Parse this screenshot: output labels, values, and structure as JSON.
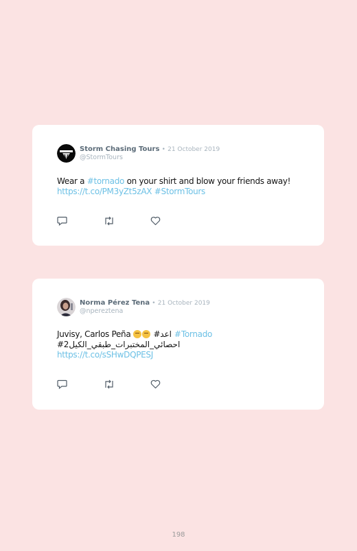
{
  "tweets": [
    {
      "author": "Storm Chasing Tours",
      "separator": "•",
      "date": "21 October 2019",
      "handle": "@StormTours",
      "text_before": "Wear a ",
      "hashtag1": "#tornado",
      "text_after": " on your shirt and blow your friends away!",
      "link": "https://t.co/PM3yZt5zAX",
      "hashtag2": "#StormTours"
    },
    {
      "author": "Norma Pérez Tena",
      "separator": "•",
      "date": "21 October 2019",
      "handle": "@npereztena",
      "text_before": "Juvisy, Carlos Peña ",
      "arabic1": "#اعد",
      "hashtag1": "#Tornado",
      "arabic2": "#احصائي_المختبرات_طبقي_الكيل2",
      "link": "https://t.co/sSHwDQPESJ"
    }
  ],
  "icons": [
    "reply-icon",
    "retweet-icon",
    "like-icon"
  ],
  "colors": {
    "background": "#fbe3e3",
    "link": "#6cc0e5",
    "name": "#5b6b78",
    "muted": "#a8b4be"
  },
  "page_number": "198"
}
